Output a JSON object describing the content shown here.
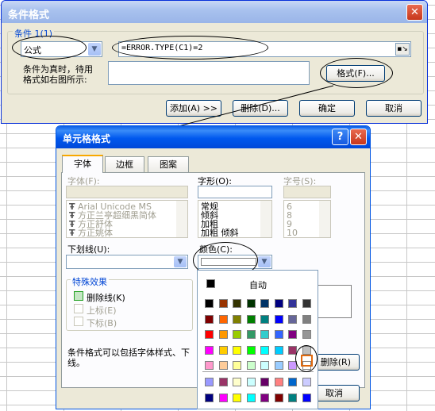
{
  "cond_dialog": {
    "title": "条件格式",
    "close": "✕",
    "condition_label": "条件 1(1)",
    "type_value": "公式",
    "formula_value": "=ERROR.TYPE(C1)=2",
    "preview_label_line1": "条件为真时，待用",
    "preview_label_line2": "格式如右图所示:",
    "format_button": "格式(F)...",
    "add_button": "添加(A) >>",
    "delete_button": "删除(D)...",
    "ok_button": "确定",
    "cancel_button": "取消"
  },
  "cell_dialog": {
    "title": "单元格格式",
    "help": "?",
    "close": "✕",
    "tabs": [
      "字体",
      "边框",
      "图案"
    ],
    "font_label": "字体(F):",
    "style_label": "字形(O):",
    "size_label": "字号(S):",
    "fonts": [
      "Arial Unicode MS",
      "方正兰亭超细黑简体",
      "方正舒体",
      "方正姚体"
    ],
    "styles": [
      "常规",
      "倾斜",
      "加粗",
      "加粗 倾斜"
    ],
    "sizes": [
      "6",
      "8",
      "9",
      "10"
    ],
    "underline_label": "下划线(U):",
    "color_label": "颜色(C):",
    "effects_title": "特殊效果",
    "strike_label": "删除线(K)",
    "super_label": "上标(E)",
    "sub_label": "下标(B)",
    "note_line1": "条件格式可以包括字体样式、下",
    "note_line2": "线。",
    "clear_button": "删除(R)",
    "cancel_button": "取消"
  },
  "palette": {
    "auto_label": "自动",
    "rows": [
      [
        "#000000",
        "#993300",
        "#333300",
        "#003300",
        "#003366",
        "#000080",
        "#333399",
        "#333333"
      ],
      [
        "#800000",
        "#FF6600",
        "#808000",
        "#008000",
        "#008080",
        "#0000FF",
        "#666699",
        "#808080"
      ],
      [
        "#FF0000",
        "#FF9900",
        "#99CC00",
        "#339966",
        "#33CCCC",
        "#3366FF",
        "#800080",
        "#969696"
      ],
      [
        "#FF00FF",
        "#FFCC00",
        "#FFFF00",
        "#00FF00",
        "#00FFFF",
        "#00CCFF",
        "#993366",
        "#C0C0C0"
      ],
      [
        "#FF99CC",
        "#FFCC99",
        "#FFFF99",
        "#CCFFCC",
        "#CCFFFF",
        "#99CCFF",
        "#CC99FF",
        "#FFFFFF"
      ]
    ],
    "extra_rows": [
      [
        "#9999FF",
        "#993366",
        "#FFFFCC",
        "#CCFFFF",
        "#660066",
        "#FF8080",
        "#0066CC",
        "#CCCCFF"
      ],
      [
        "#000080",
        "#FF00FF",
        "#FFFF00",
        "#00FFFF",
        "#800080",
        "#800000",
        "#008080",
        "#0000FF"
      ]
    ]
  }
}
